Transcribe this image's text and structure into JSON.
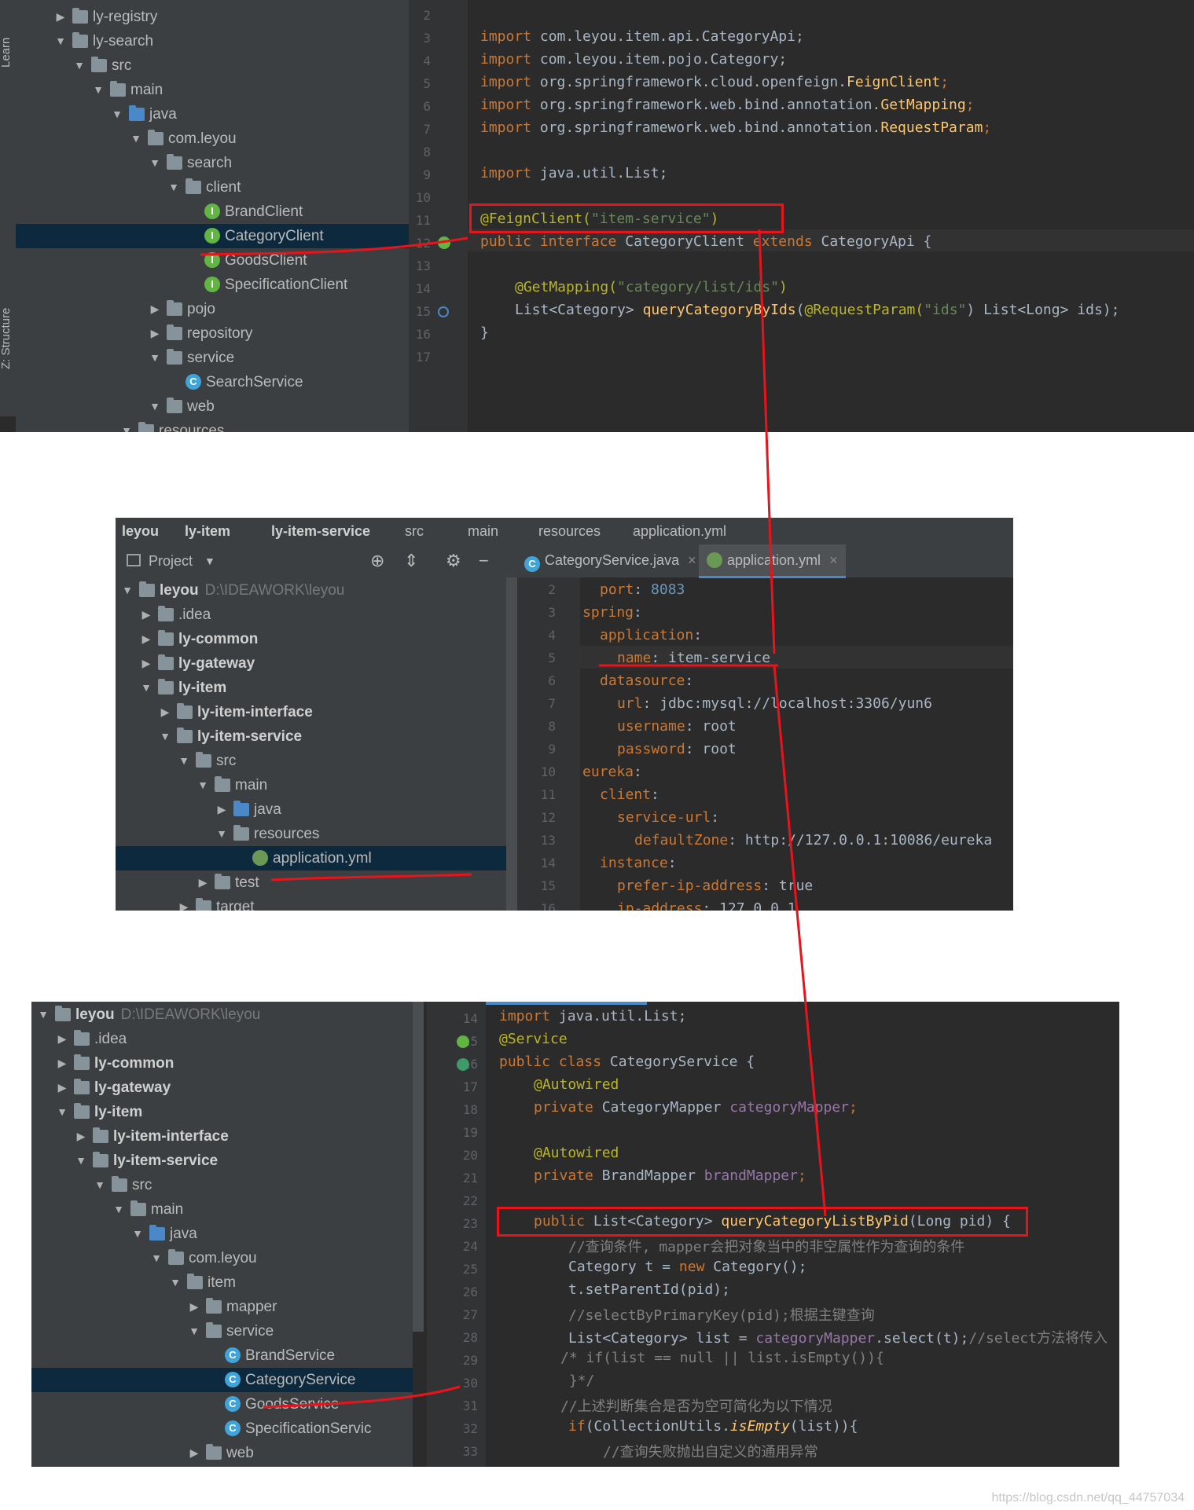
{
  "panel1": {
    "side_tabs": [
      "Learn",
      "Z: Structure"
    ],
    "tree": [
      {
        "label": "ly-registry",
        "arrow": "▶",
        "icon": "module"
      },
      {
        "label": "ly-search",
        "arrow": "▼",
        "icon": "module"
      },
      {
        "label": "src",
        "arrow": "▼",
        "icon": "folder"
      },
      {
        "label": "main",
        "arrow": "▼",
        "icon": "folder"
      },
      {
        "label": "java",
        "arrow": "▼",
        "icon": "src-folder"
      },
      {
        "label": "com.leyou",
        "arrow": "▼",
        "icon": "folder"
      },
      {
        "label": "search",
        "arrow": "▼",
        "icon": "folder"
      },
      {
        "label": "client",
        "arrow": "▼",
        "icon": "folder"
      },
      {
        "label": "BrandClient",
        "arrow": "",
        "icon": "interface"
      },
      {
        "label": "CategoryClient",
        "arrow": "",
        "icon": "interface",
        "selected": true
      },
      {
        "label": "GoodsClient",
        "arrow": "",
        "icon": "interface"
      },
      {
        "label": "SpecificationClient",
        "arrow": "",
        "icon": "interface"
      },
      {
        "label": "pojo",
        "arrow": "▶",
        "icon": "folder"
      },
      {
        "label": "repository",
        "arrow": "▶",
        "icon": "folder"
      },
      {
        "label": "service",
        "arrow": "▼",
        "icon": "folder"
      },
      {
        "label": "SearchService",
        "arrow": "",
        "icon": "class"
      },
      {
        "label": "web",
        "arrow": "▼",
        "icon": "folder"
      },
      {
        "label": "resources",
        "arrow": "▼",
        "icon": "folder"
      }
    ],
    "line_numbers": [
      "2",
      "3",
      "4",
      "5",
      "6",
      "7",
      "8",
      "9",
      "10",
      "11",
      "12",
      "13",
      "14",
      "15",
      "16",
      "17"
    ],
    "code": {
      "l3_pkg": "com.leyou.item.api.CategoryApi;",
      "l4_pkg": "com.leyou.item.pojo.Category;",
      "l5_pkg": "org.springframework.cloud.openfeign.",
      "l5_cls": "FeignClient",
      "l6_pkg": "org.springframework.web.bind.annotation.",
      "l6_cls": "GetMapping",
      "l7_pkg": "org.springframework.web.bind.annotation.",
      "l7_cls": "RequestParam",
      "l9_pkg": "java.util.List;",
      "kw_import": "import",
      "l11_ann": "@FeignClient(",
      "l11_str": "\"item-service\"",
      "l11_end": ")",
      "l12_kw1": "public interface ",
      "l12_name": "CategoryClient ",
      "l12_kw2": "extends ",
      "l12_rest": "CategoryApi {",
      "l14_ann": "@GetMapping(",
      "l14_str": "\"category/list/ids\"",
      "l14_end": ")",
      "l15_a": "List<Category> ",
      "l15_fn": "queryCategoryByIds",
      "l15_b": "(",
      "l15_ann": "@RequestParam(",
      "l15_str": "\"ids\"",
      "l15_c": ") List<Long> ids);",
      "l16": "}"
    }
  },
  "panel2": {
    "breadcrumbs": [
      "leyou",
      "ly-item",
      "ly-item-service",
      "src",
      "main",
      "resources",
      "application.yml"
    ],
    "project_label": "Project",
    "tabs": [
      "CategoryService.java",
      "application.yml"
    ],
    "tree": [
      {
        "label": "leyou",
        "path": "D:\\IDEAWORK\\leyou",
        "arrow": "▼",
        "icon": "module",
        "bold": true
      },
      {
        "label": ".idea",
        "arrow": "▶",
        "icon": "folder"
      },
      {
        "label": "ly-common",
        "arrow": "▶",
        "icon": "module",
        "bold": true
      },
      {
        "label": "ly-gateway",
        "arrow": "▶",
        "icon": "module",
        "bold": true
      },
      {
        "label": "ly-item",
        "arrow": "▼",
        "icon": "module",
        "bold": true
      },
      {
        "label": "ly-item-interface",
        "arrow": "▶",
        "icon": "module",
        "bold": true
      },
      {
        "label": "ly-item-service",
        "arrow": "▼",
        "icon": "module",
        "bold": true
      },
      {
        "label": "src",
        "arrow": "▼",
        "icon": "folder"
      },
      {
        "label": "main",
        "arrow": "▼",
        "icon": "folder"
      },
      {
        "label": "java",
        "arrow": "▶",
        "icon": "src-folder"
      },
      {
        "label": "resources",
        "arrow": "▼",
        "icon": "folder"
      },
      {
        "label": "application.yml",
        "arrow": "",
        "icon": "yml",
        "selected": true
      },
      {
        "label": "test",
        "arrow": "▶",
        "icon": "folder"
      },
      {
        "label": "target",
        "arrow": "▶",
        "icon": "folder"
      }
    ],
    "line_numbers": [
      "2",
      "3",
      "4",
      "5",
      "6",
      "7",
      "8",
      "9",
      "10",
      "11",
      "12",
      "13",
      "14",
      "15",
      "16"
    ],
    "yaml": [
      {
        "indent": 1,
        "key": "port",
        "value": "8083",
        "num": true
      },
      {
        "indent": 0,
        "key": "spring",
        "value": ""
      },
      {
        "indent": 1,
        "key": "application",
        "value": ""
      },
      {
        "indent": 2,
        "key": "name",
        "value": "item-service"
      },
      {
        "indent": 1,
        "key": "datasource",
        "value": ""
      },
      {
        "indent": 2,
        "key": "url",
        "value": "jdbc:mysql://localhost:3306/yun6"
      },
      {
        "indent": 2,
        "key": "username",
        "value": "root"
      },
      {
        "indent": 2,
        "key": "password",
        "value": "root"
      },
      {
        "indent": 0,
        "key": "eureka",
        "value": ""
      },
      {
        "indent": 1,
        "key": "client",
        "value": ""
      },
      {
        "indent": 2,
        "key": "service-url",
        "value": ""
      },
      {
        "indent": 3,
        "key": "defaultZone",
        "value": "http://127.0.0.1:10086/eureka"
      },
      {
        "indent": 1,
        "key": "instance",
        "value": ""
      },
      {
        "indent": 2,
        "key": "prefer-ip-address",
        "value": "true"
      },
      {
        "indent": 2,
        "key": "ip-address",
        "value": "127.0.0.1"
      }
    ]
  },
  "panel3": {
    "tree": [
      {
        "label": "leyou",
        "path": "D:\\IDEAWORK\\leyou",
        "arrow": "▼",
        "icon": "module",
        "bold": true
      },
      {
        "label": ".idea",
        "arrow": "▶",
        "icon": "folder"
      },
      {
        "label": "ly-common",
        "arrow": "▶",
        "icon": "module",
        "bold": true
      },
      {
        "label": "ly-gateway",
        "arrow": "▶",
        "icon": "module",
        "bold": true
      },
      {
        "label": "ly-item",
        "arrow": "▼",
        "icon": "module",
        "bold": true
      },
      {
        "label": "ly-item-interface",
        "arrow": "▶",
        "icon": "module",
        "bold": true
      },
      {
        "label": "ly-item-service",
        "arrow": "▼",
        "icon": "module",
        "bold": true
      },
      {
        "label": "src",
        "arrow": "▼",
        "icon": "folder"
      },
      {
        "label": "main",
        "arrow": "▼",
        "icon": "folder"
      },
      {
        "label": "java",
        "arrow": "▼",
        "icon": "src-folder"
      },
      {
        "label": "com.leyou",
        "arrow": "▼",
        "icon": "folder"
      },
      {
        "label": "item",
        "arrow": "▼",
        "icon": "folder"
      },
      {
        "label": "mapper",
        "arrow": "▶",
        "icon": "folder"
      },
      {
        "label": "service",
        "arrow": "▼",
        "icon": "folder"
      },
      {
        "label": "BrandService",
        "arrow": "",
        "icon": "class"
      },
      {
        "label": "CategoryService",
        "arrow": "",
        "icon": "class",
        "selected": true
      },
      {
        "label": "GoodsService",
        "arrow": "",
        "icon": "class"
      },
      {
        "label": "SpecificationServic",
        "arrow": "",
        "icon": "class"
      },
      {
        "label": "web",
        "arrow": "▶",
        "icon": "folder"
      }
    ],
    "line_numbers": [
      "14",
      "15",
      "16",
      "17",
      "18",
      "19",
      "20",
      "21",
      "22",
      "23",
      "24",
      "25",
      "26",
      "27",
      "28",
      "29",
      "30",
      "31",
      "32",
      "33"
    ],
    "code": {
      "l14_kw": "import ",
      "l14_rest": "java.util.List;",
      "l15": "@Service",
      "l16_kw": "public class ",
      "l16_rest": "CategoryService {",
      "l17": "@Autowired",
      "l18_kw": "private ",
      "l18_type": "CategoryMapper ",
      "l18_fld": "categoryMapper",
      "l18_end": ";",
      "l20": "@Autowired",
      "l21_kw": "private ",
      "l21_type": "BrandMapper ",
      "l21_fld": "brandMapper",
      "l21_end": ";",
      "l23_kw": "public ",
      "l23_type": "List<Category> ",
      "l23_fn": "queryCategoryListByPid",
      "l23_rest": "(Long pid) {",
      "l24": "//查询条件, mapper会把对象当中的非空属性作为查询的条件",
      "l25_a": "Category t = ",
      "l25_kw": "new ",
      "l25_b": "Category();",
      "l26": "t.setParentId(pid);",
      "l27": "//selectByPrimaryKey(pid);根据主键查询",
      "l28_a": "List<Category> list = ",
      "l28_fld": "categoryMapper",
      "l28_b": ".select(t);",
      "l28_cmt": "//select方法将传入",
      "l29": "/* if(list == null || list.isEmpty()){",
      "l30": " }*/",
      "l31": "//上述判断集合是否为空可简化为以下情况",
      "l32_kw": "if",
      "l32_a": "(CollectionUtils.",
      "l32_fn": "isEmpty",
      "l32_b": "(list)){",
      "l33": "//查询失败抛出自定义的通用异常"
    }
  },
  "watermark": "https://blog.csdn.net/qq_44757034",
  "colors": {
    "highlight_red": "#e8141c",
    "selection": "#0d293e",
    "editor_bg": "#2b2b2b",
    "tree_bg": "#3c3f41"
  }
}
